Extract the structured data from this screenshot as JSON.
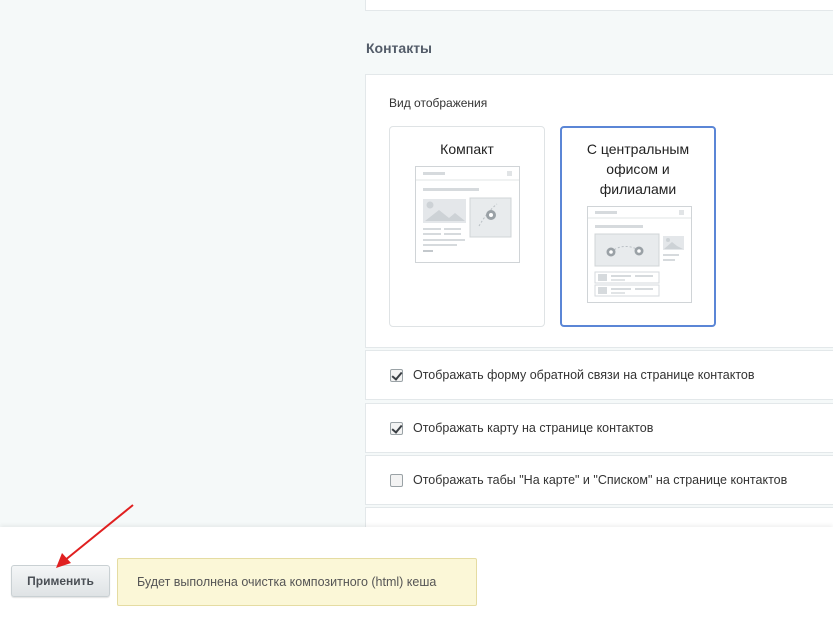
{
  "contacts": {
    "section_title": "Контакты",
    "view_label": "Вид отображения",
    "options": [
      {
        "title": "Компакт",
        "selected": false
      },
      {
        "title": "С центральным офисом и филиалами",
        "selected": true
      }
    ],
    "checkboxes": [
      {
        "label": "Отображать форму обратной связи на странице контактов",
        "checked": true
      },
      {
        "label": "Отображать карту на странице контактов",
        "checked": true
      },
      {
        "label": "Отображать табы \"На карте\" и \"Списком\" на странице контактов",
        "checked": false
      }
    ]
  },
  "footer": {
    "apply_label": "Применить",
    "notice_text": "Будет выполнена очистка композитного (html) кеша"
  },
  "colors": {
    "selected_border": "#5b86d6",
    "notice_bg": "#fbf7d7",
    "annotation_arrow": "#e02020"
  },
  "icons": {
    "annotation": "red-arrow-icon",
    "checkbox_checked": "checkmark-icon",
    "map_pin": "map-pin-icon"
  }
}
